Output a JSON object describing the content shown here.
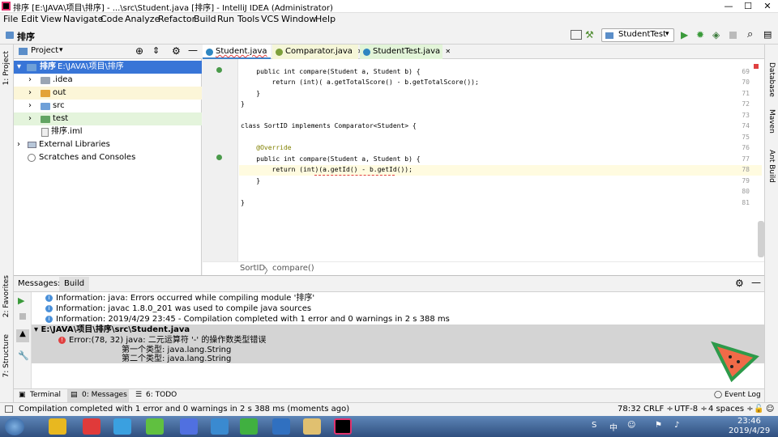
{
  "window": {
    "title": "排序 [E:\\JAVA\\项目\\排序] - ...\\src\\Student.java [排序] - IntelliJ IDEA (Administrator)",
    "minimize": "—",
    "maximize": "☐",
    "close": "✕"
  },
  "menu": [
    "File",
    "Edit",
    "View",
    "Navigate",
    "Code",
    "Analyze",
    "Refactor",
    "Build",
    "Run",
    "Tools",
    "VCS",
    "Window",
    "Help"
  ],
  "nav": {
    "project_name": "排序",
    "run_config": "StudentTest"
  },
  "project_panel": {
    "title": "Project",
    "tree": [
      {
        "label": "排序",
        "path": "E:\\JAVA\\项目\\排序",
        "type": "root"
      },
      {
        "label": ".idea",
        "type": "folder"
      },
      {
        "label": "out",
        "type": "folder"
      },
      {
        "label": "src",
        "type": "folder"
      },
      {
        "label": "test",
        "type": "folder"
      },
      {
        "label": "排序.iml",
        "type": "file"
      },
      {
        "label": "External Libraries",
        "type": "lib"
      },
      {
        "label": "Scratches and Consoles",
        "type": "scratch"
      }
    ]
  },
  "left_strip": {
    "project": "1: Project",
    "favorites": "2: Favorites",
    "structure": "7: Structure"
  },
  "right_strip": {
    "database": "Database",
    "maven": "Maven",
    "ant": "Ant Build"
  },
  "editor_tabs": [
    {
      "label": "Student.java",
      "active": true
    },
    {
      "label": "Comparator.java",
      "active": false
    },
    {
      "label": "StudentTest.java",
      "active": false
    }
  ],
  "code": {
    "lines": [
      {
        "num": "69",
        "text": "    public int compare(Student a, Student b) {"
      },
      {
        "num": "70",
        "text": "        return (int)( a.getTotalScore() - b.getTotalScore());"
      },
      {
        "num": "71",
        "text": "    }"
      },
      {
        "num": "72",
        "text": "}"
      },
      {
        "num": "73",
        "text": ""
      },
      {
        "num": "74",
        "text": "class SortID implements Comparator<Student> {"
      },
      {
        "num": "75",
        "text": ""
      },
      {
        "num": "76",
        "text": "    @Override"
      },
      {
        "num": "77",
        "text": "    public int compare(Student a, Student b) {"
      },
      {
        "num": "78",
        "text": "        return (int)(a.getId() - b.getId());"
      },
      {
        "num": "79",
        "text": "    }"
      },
      {
        "num": "80",
        "text": ""
      },
      {
        "num": "81",
        "text": "}"
      }
    ]
  },
  "breadcrumb": {
    "cls": "SortID",
    "sep": "〉",
    "method": "compare()"
  },
  "messages": {
    "title": "Messages:",
    "tab": "Build",
    "lines": [
      "Information: java: Errors occurred while compiling module '排序'",
      "Information: javac 1.8.0_201 was used to compile java sources",
      "Information: 2019/4/29 23:45 - Compilation completed with 1 error and 0 warnings in 2 s 388 ms"
    ],
    "file": "E:\\JAVA\\项目\\排序\\src\\Student.java",
    "error": "Error:(78, 32)  java: 二元运算符 '-' 的操作数类型错误",
    "detail1": "第一个类型:  java.lang.String",
    "detail2": "第二个类型: java.lang.String"
  },
  "bottom_tabs": {
    "terminal": "Terminal",
    "messages": "0: Messages",
    "todo": "6: TODO",
    "event_log": "Event Log"
  },
  "status": {
    "text": "Compilation completed with 1 error and 0 warnings in 2 s 388 ms (moments ago)",
    "position": "78:32",
    "line_sep": "CRLF ÷",
    "encoding": "UTF-8 ÷",
    "indent": "4 spaces ÷"
  },
  "taskbar": {
    "time": "23:46",
    "date": "2019/4/29",
    "ime": "中"
  }
}
